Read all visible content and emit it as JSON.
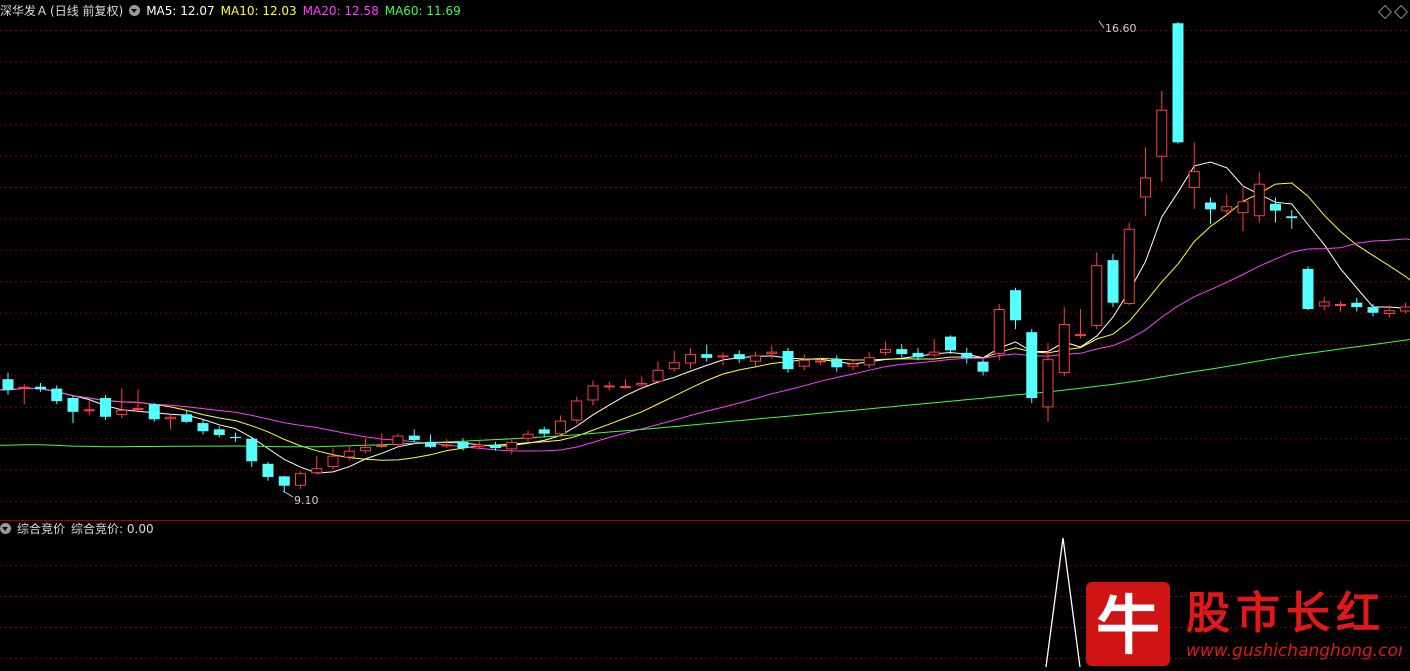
{
  "main_header": {
    "stock": "深华发Ａ",
    "period": "(日线 前复权)",
    "ma5": "MA5: 12.07",
    "ma10": "MA10: 12.03",
    "ma20": "MA20: 12.58",
    "ma60": "MA60: 11.69"
  },
  "sub_header": {
    "indicator": "综合竞价",
    "value": "综合竞价: 0.00"
  },
  "annotations": {
    "high": "16.60",
    "low": "9.10"
  },
  "watermark": {
    "logo_char": "牛",
    "title": "股市长红",
    "url": "www.gushichanghong.com"
  },
  "colors": {
    "up": "#ff3c3c",
    "down": "#54ffff",
    "ma5": "#ffffff",
    "ma10": "#ffff3c",
    "ma20": "#ff3cff",
    "ma60": "#3cff3c",
    "grid": "#7a0000"
  },
  "chart_data": {
    "type": "candlestick",
    "price_range": [
      8.8,
      17.0
    ],
    "candles": [
      [
        10.9,
        10.73,
        11.0,
        10.65
      ],
      [
        10.75,
        10.78,
        10.82,
        10.5
      ],
      [
        10.78,
        10.74,
        10.84,
        10.7
      ],
      [
        10.75,
        10.55,
        10.8,
        10.5
      ],
      [
        10.6,
        10.38,
        10.65,
        10.2
      ],
      [
        10.4,
        10.42,
        10.55,
        10.32
      ],
      [
        10.6,
        10.3,
        10.65,
        10.25
      ],
      [
        10.33,
        10.41,
        10.75,
        10.28
      ],
      [
        10.41,
        10.44,
        10.74,
        10.4
      ],
      [
        10.5,
        10.26,
        10.52,
        10.22
      ],
      [
        10.26,
        10.3,
        10.34,
        10.1
      ],
      [
        10.34,
        10.22,
        10.4,
        10.2
      ],
      [
        10.2,
        10.07,
        10.25,
        10.02
      ],
      [
        10.1,
        10.01,
        10.15,
        9.97
      ],
      [
        9.98,
        9.96,
        10.05,
        9.9
      ],
      [
        9.95,
        9.59,
        9.98,
        9.5
      ],
      [
        9.55,
        9.34,
        9.58,
        9.28
      ],
      [
        9.35,
        9.2,
        9.36,
        9.1
      ],
      [
        9.2,
        9.4,
        9.43,
        9.15
      ],
      [
        9.4,
        9.48,
        9.68,
        9.38
      ],
      [
        9.5,
        9.68,
        9.8,
        9.46
      ],
      [
        9.65,
        9.76,
        9.85,
        9.6
      ],
      [
        9.75,
        9.82,
        9.96,
        9.72
      ],
      [
        9.85,
        9.85,
        10.04,
        9.8
      ],
      [
        9.85,
        10.0,
        10.03,
        9.82
      ],
      [
        10.0,
        9.93,
        10.1,
        9.9
      ],
      [
        9.9,
        9.82,
        10.02,
        9.8
      ],
      [
        9.85,
        9.86,
        9.94,
        9.8
      ],
      [
        9.9,
        9.8,
        9.96,
        9.76
      ],
      [
        9.82,
        9.86,
        9.92,
        9.78
      ],
      [
        9.85,
        9.8,
        9.9,
        9.76
      ],
      [
        9.78,
        9.9,
        9.95,
        9.7
      ],
      [
        9.95,
        10.03,
        10.08,
        9.9
      ],
      [
        10.1,
        10.03,
        10.14,
        9.98
      ],
      [
        10.02,
        10.24,
        10.32,
        9.98
      ],
      [
        10.24,
        10.56,
        10.62,
        10.2
      ],
      [
        10.56,
        10.8,
        10.88,
        10.48
      ],
      [
        10.78,
        10.8,
        10.86,
        10.72
      ],
      [
        10.77,
        10.79,
        10.9,
        10.75
      ],
      [
        10.8,
        10.84,
        10.94,
        10.78
      ],
      [
        10.86,
        11.05,
        11.18,
        10.82
      ],
      [
        11.06,
        11.17,
        11.35,
        11.02
      ],
      [
        11.15,
        11.3,
        11.4,
        11.06
      ],
      [
        11.3,
        11.24,
        11.45,
        11.18
      ],
      [
        11.26,
        11.28,
        11.33,
        11.12
      ],
      [
        11.3,
        11.22,
        11.36,
        11.16
      ],
      [
        11.18,
        11.28,
        11.34,
        11.1
      ],
      [
        11.3,
        11.34,
        11.44,
        11.22
      ],
      [
        11.35,
        11.06,
        11.4,
        11.0
      ],
      [
        11.1,
        11.21,
        11.3,
        11.04
      ],
      [
        11.2,
        11.2,
        11.25,
        11.13
      ],
      [
        11.22,
        11.09,
        11.28,
        11.02
      ],
      [
        11.1,
        11.15,
        11.2,
        11.04
      ],
      [
        11.12,
        11.25,
        11.33,
        11.08
      ],
      [
        11.32,
        11.38,
        11.5,
        11.28
      ],
      [
        11.38,
        11.3,
        11.46,
        11.25
      ],
      [
        11.32,
        11.25,
        11.4,
        11.2
      ],
      [
        11.28,
        11.34,
        11.54,
        11.25
      ],
      [
        11.58,
        11.36,
        11.6,
        11.3
      ],
      [
        11.32,
        11.24,
        11.4,
        11.15
      ],
      [
        11.18,
        11.02,
        11.22,
        10.96
      ],
      [
        11.3,
        12.02,
        12.1,
        11.2
      ],
      [
        12.32,
        11.84,
        12.36,
        11.7
      ],
      [
        11.65,
        10.6,
        11.7,
        10.52
      ],
      [
        10.45,
        11.22,
        11.48,
        10.22
      ],
      [
        11.0,
        11.78,
        12.05,
        10.95
      ],
      [
        11.6,
        11.62,
        12.02,
        11.55
      ],
      [
        11.75,
        12.72,
        12.92,
        11.7
      ],
      [
        12.8,
        12.12,
        12.9,
        12.05
      ],
      [
        12.1,
        13.3,
        13.4,
        12.08
      ],
      [
        13.8,
        14.12,
        14.6,
        13.5
      ],
      [
        14.45,
        15.2,
        15.5,
        14.05
      ],
      [
        16.58,
        14.68,
        16.6,
        14.66
      ],
      [
        13.95,
        14.22,
        14.68,
        13.62
      ],
      [
        13.72,
        13.61,
        13.8,
        13.37
      ],
      [
        13.58,
        13.66,
        13.85,
        13.5
      ],
      [
        13.55,
        13.74,
        14.0,
        13.26
      ],
      [
        13.5,
        14.02,
        14.2,
        13.4
      ],
      [
        13.7,
        13.59,
        13.8,
        13.4
      ],
      [
        13.5,
        13.47,
        13.6,
        13.3
      ],
      [
        12.66,
        12.02,
        12.7,
        12.0
      ],
      [
        12.06,
        12.14,
        12.22,
        12.0
      ],
      [
        12.09,
        12.1,
        12.14,
        11.98
      ],
      [
        12.12,
        12.05,
        12.2,
        11.98
      ],
      [
        12.05,
        11.96,
        12.1,
        11.9
      ],
      [
        11.94,
        12.0,
        12.08,
        11.88
      ],
      [
        11.98,
        12.06,
        12.12,
        11.95
      ],
      [
        12.0,
        12.02,
        12.07,
        11.94
      ],
      [
        12.07,
        12.04,
        12.12,
        11.98
      ],
      [
        12.04,
        11.99,
        12.08,
        11.94
      ],
      [
        11.98,
        12.08,
        12.15,
        11.95
      ],
      [
        12.05,
        12.13,
        12.2,
        11.98
      ],
      [
        12.08,
        12.12,
        12.24,
        12.05
      ]
    ],
    "ma60_end": 11.69
  }
}
